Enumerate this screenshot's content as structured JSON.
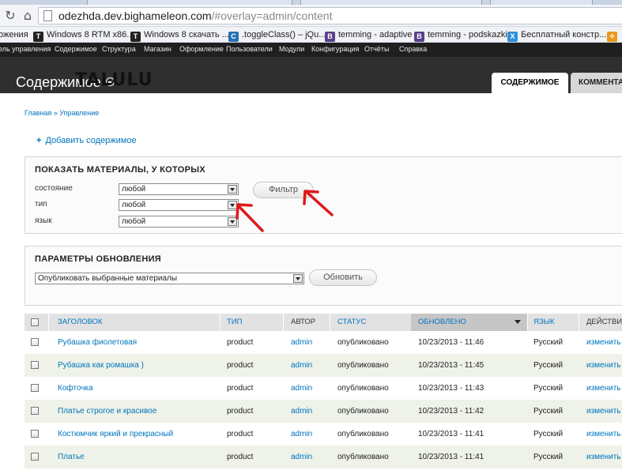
{
  "browser": {
    "url_host": "odezhda.dev.bighameleon.com",
    "url_path": "/#overlay=admin/content"
  },
  "bookmarks": [
    {
      "label": "ожения",
      "icon": "",
      "color": ""
    },
    {
      "label": "Windows 8 RTM x86...",
      "icon": "T",
      "color": "#222222"
    },
    {
      "label": "Windows 8 скачать ...",
      "icon": "T",
      "color": "#222222"
    },
    {
      "label": ".toggleClass() – jQu...",
      "icon": "C",
      "color": "#2a6fb5"
    },
    {
      "label": "temming - adaptive",
      "icon": "B",
      "color": "#5b3f8c"
    },
    {
      "label": "temming - podskazki",
      "icon": "B",
      "color": "#5b3f8c"
    },
    {
      "label": "Бесплатный констр...",
      "icon": "X",
      "color": "#2d8fd8"
    },
    {
      "label": "",
      "icon": "✧",
      "color": "#e89a1e"
    }
  ],
  "admin_bar": [
    "ель управления",
    "Содержимое",
    "Структура",
    "Магазин",
    "Оформление",
    "Пользователи",
    "Модули",
    "Конфигурация",
    "Отчёты",
    "Справка"
  ],
  "overlay": {
    "title": "Содержимое",
    "watermark": "TALULU",
    "tab_active": "СОДЕРЖИМОЕ",
    "tab_inactive": "КОММЕНТА"
  },
  "breadcrumb": "Главная » Управление",
  "add_content": "Добавить содержимое",
  "filter": {
    "title": "ПОКАЗАТЬ МАТЕРИАЛЫ, У КОТОРЫХ",
    "status_label": "состояние",
    "status_value": "любой",
    "type_label": "тип",
    "type_value": "любой",
    "lang_label": "язык",
    "lang_value": "любой",
    "button": "Фильтр"
  },
  "update": {
    "title": "ПАРАМЕТРЫ ОБНОВЛЕНИЯ",
    "action_value": "Опубликовать выбранные материалы",
    "button": "Обновить"
  },
  "table": {
    "headers": {
      "title": "ЗАГОЛОВОК",
      "type": "ТИП",
      "author": "АВТОР",
      "status": "СТАТУС",
      "updated": "ОБНОВЛЕНО",
      "language": "ЯЗЫК",
      "actions": "ДЕЙСТВИЯ"
    },
    "rows": [
      {
        "title": "Рубашка фиолетовая",
        "type": "product",
        "author": "admin",
        "status": "опубликовано",
        "updated": "10/23/2013 - 11:46",
        "language": "Русский",
        "action": "изменить"
      },
      {
        "title": "Рубашка как ромашка )",
        "type": "product",
        "author": "admin",
        "status": "опубликовано",
        "updated": "10/23/2013 - 11:45",
        "language": "Русский",
        "action": "изменить"
      },
      {
        "title": "Кофточка",
        "type": "product",
        "author": "admin",
        "status": "опубликовано",
        "updated": "10/23/2013 - 11:43",
        "language": "Русский",
        "action": "изменить"
      },
      {
        "title": "Платье строгое и красивое",
        "type": "product",
        "author": "admin",
        "status": "опубликовано",
        "updated": "10/23/2013 - 11:42",
        "language": "Русский",
        "action": "изменить"
      },
      {
        "title": "Костюмчик яркий и прекрасный",
        "type": "product",
        "author": "admin",
        "status": "опубликовано",
        "updated": "10/23/2013 - 11:41",
        "language": "Русский",
        "action": "изменить"
      },
      {
        "title": "Платье",
        "type": "product",
        "author": "admin",
        "status": "опубликовано",
        "updated": "10/23/2013 - 11:41",
        "language": "Русский",
        "action": "изменить"
      }
    ]
  },
  "colors": {
    "link": "#0074bd",
    "admin_bar": "#1f1f1f",
    "overlay_header": "#2f2f2f",
    "annotation_arrow": "#e0191b",
    "row_even": "#eef2e9"
  }
}
